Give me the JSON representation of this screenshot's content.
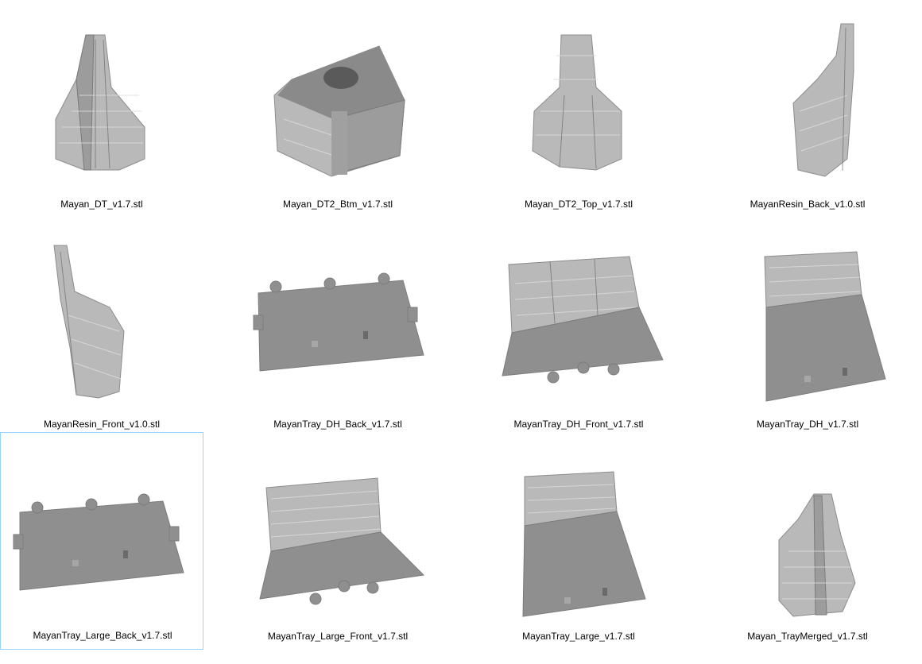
{
  "files": [
    {
      "name": "Mayan_DT_v1.7.stl",
      "icon": "pyramid-icon",
      "selected": false
    },
    {
      "name": "Mayan_DT2_Btm_v1.7.stl",
      "icon": "temple-base-icon",
      "selected": false
    },
    {
      "name": "Mayan_DT2_Top_v1.7.stl",
      "icon": "pyramid-top-icon",
      "selected": false
    },
    {
      "name": "MayanResin_Back_v1.0.stl",
      "icon": "stair-wall-icon",
      "selected": false
    },
    {
      "name": "MayanResin_Front_v1.0.stl",
      "icon": "stair-wall-icon",
      "selected": false
    },
    {
      "name": "MayanTray_DH_Back_v1.7.stl",
      "icon": "puzzle-tray-icon",
      "selected": false
    },
    {
      "name": "MayanTray_DH_Front_v1.7.stl",
      "icon": "tray-with-stairs-icon",
      "selected": false
    },
    {
      "name": "MayanTray_DH_v1.7.stl",
      "icon": "tray-with-stairs-icon",
      "selected": false
    },
    {
      "name": "MayanTray_Large_Back_v1.7.stl",
      "icon": "puzzle-tray-icon",
      "selected": true
    },
    {
      "name": "MayanTray_Large_Front_v1.7.stl",
      "icon": "tray-with-stairs-icon",
      "selected": false
    },
    {
      "name": "MayanTray_Large_v1.7.stl",
      "icon": "tray-with-stairs-icon",
      "selected": false
    },
    {
      "name": "Mayan_TrayMerged_v1.7.stl",
      "icon": "pyramid-icon",
      "selected": false
    }
  ],
  "colors": {
    "selection_border": "#99d1ff",
    "model_gray": "#8f8f8f",
    "stone_light": "#b9b9b9"
  }
}
